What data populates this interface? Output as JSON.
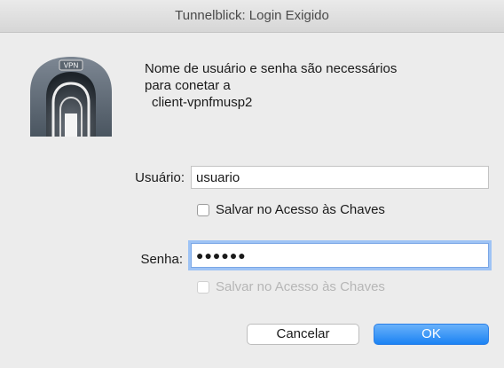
{
  "window": {
    "title": "Tunnelblick: Login Exigido"
  },
  "icon": {
    "name": "tunnelblick-vpn-icon",
    "badge_text": "VPN"
  },
  "message": {
    "line1": "Nome de usuário e senha são necessários",
    "line2": "para conetar a",
    "connection": "client-vpnfmusp2"
  },
  "form": {
    "username_label": "Usuário:",
    "username_value": "usuario",
    "save_username_label": "Salvar no Acesso às Chaves",
    "password_label": "Senha:",
    "password_masked": "●●●●●●",
    "save_password_label": "Salvar no Acesso às Chaves"
  },
  "buttons": {
    "cancel_label": "Cancelar",
    "ok_label": "OK"
  },
  "colors": {
    "accent": "#1b83f3",
    "window_bg": "#ececec"
  }
}
